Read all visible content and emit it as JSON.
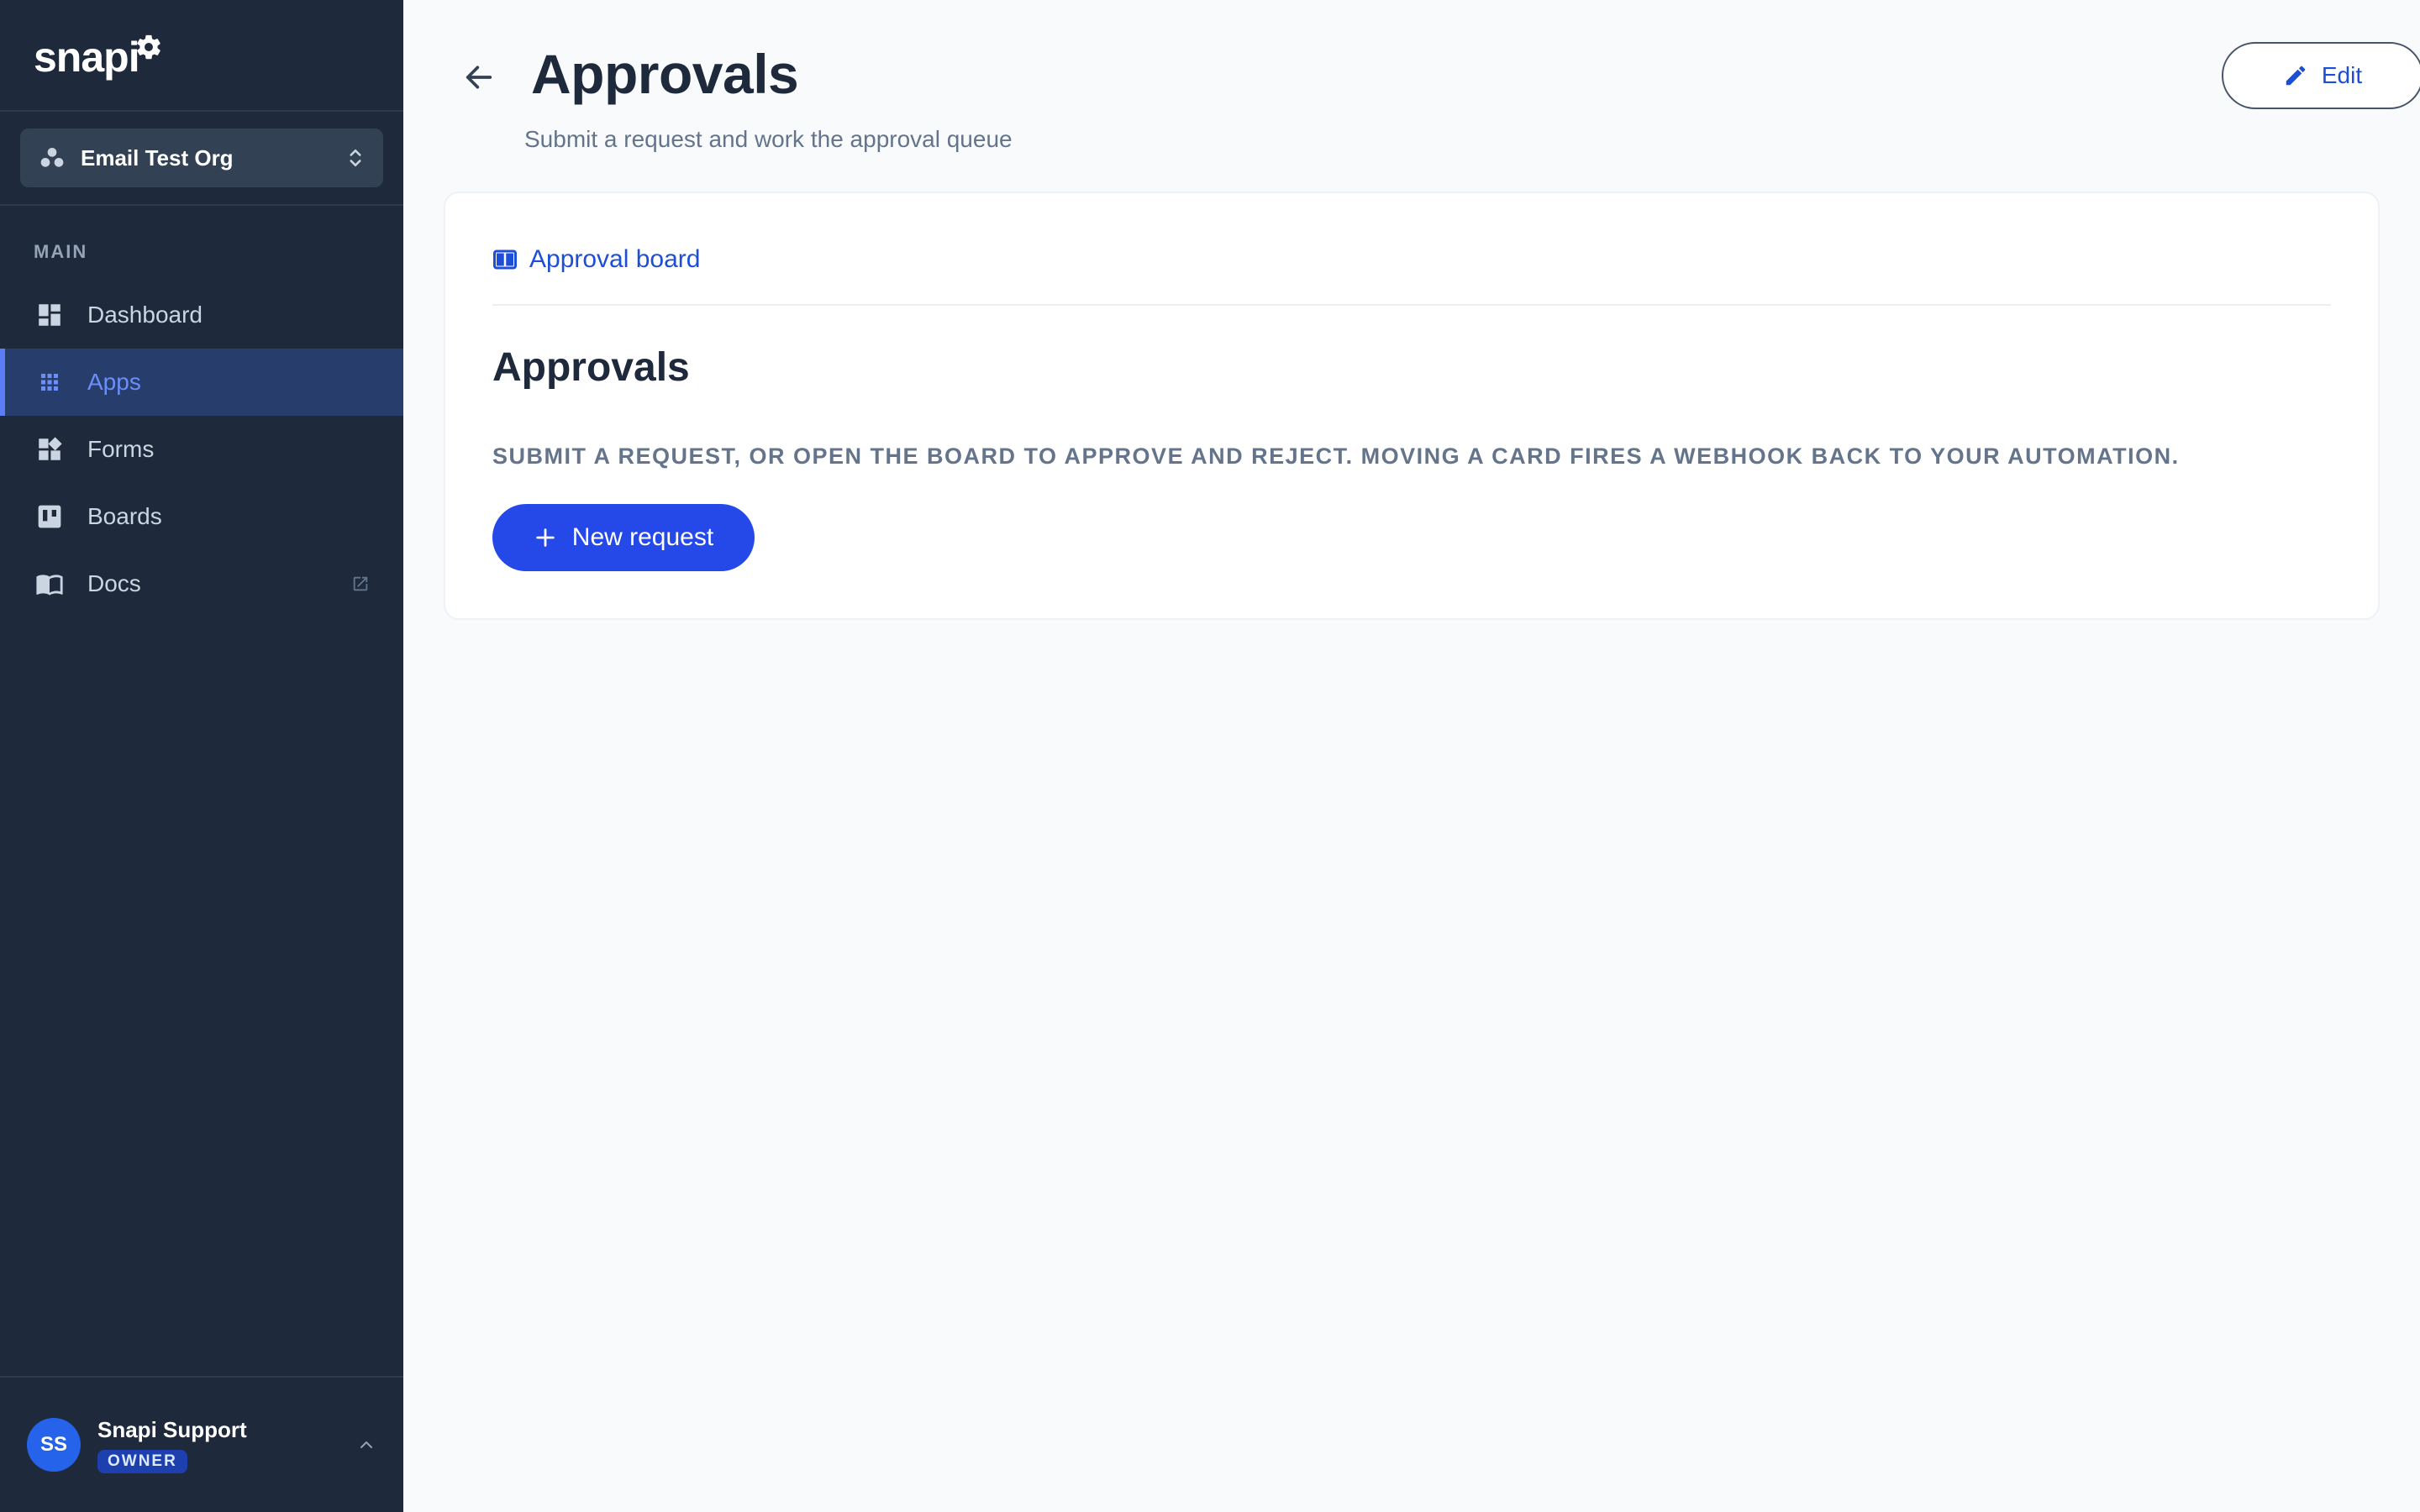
{
  "app": {
    "logo_text": "snapi",
    "brand_color": "#2548e9"
  },
  "org": {
    "name": "Email Test Org"
  },
  "sidebar": {
    "section_heading": "MAIN",
    "items": [
      {
        "label": "Dashboard",
        "icon": "dashboard-icon",
        "active": false
      },
      {
        "label": "Apps",
        "icon": "apps-grid-icon",
        "active": true
      },
      {
        "label": "Forms",
        "icon": "forms-icon",
        "active": false
      },
      {
        "label": "Boards",
        "icon": "boards-icon",
        "active": false
      },
      {
        "label": "Docs",
        "icon": "docs-book-icon",
        "active": false,
        "external": true
      }
    ]
  },
  "user": {
    "initials": "SS",
    "name": "Snapi Support",
    "role": "OWNER"
  },
  "header": {
    "title": "Approvals",
    "subtitle": "Submit a request and work the approval queue",
    "edit_label": "Edit"
  },
  "card": {
    "tab_label": "Approval board",
    "title": "Approvals",
    "description": "SUBMIT A REQUEST, OR OPEN THE BOARD TO APPROVE AND REJECT. MOVING A CARD FIRES A WEBHOOK BACK TO YOUR AUTOMATION.",
    "new_request_label": "New request"
  }
}
